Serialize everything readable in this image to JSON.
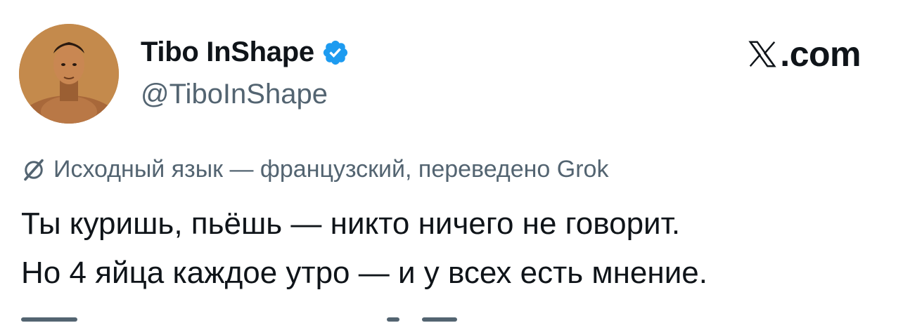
{
  "author": {
    "display_name": "Tibo InShape",
    "handle": "@TiboInShape",
    "verified": true
  },
  "brand": {
    "site": ".com",
    "logo_icon": "x-logo-icon"
  },
  "translation": {
    "icon": "grok-icon",
    "label": "Исходный язык — французский, переведено Grok"
  },
  "tweet": {
    "lines": [
      "Ты куришь, пьёшь — никто ничего не говорит.",
      "Но 4 яйца каждое утро — и у всех есть мнение."
    ]
  },
  "colors": {
    "text": "#0f1419",
    "secondary": "#536471",
    "verified_blue": "#1d9bf0"
  }
}
